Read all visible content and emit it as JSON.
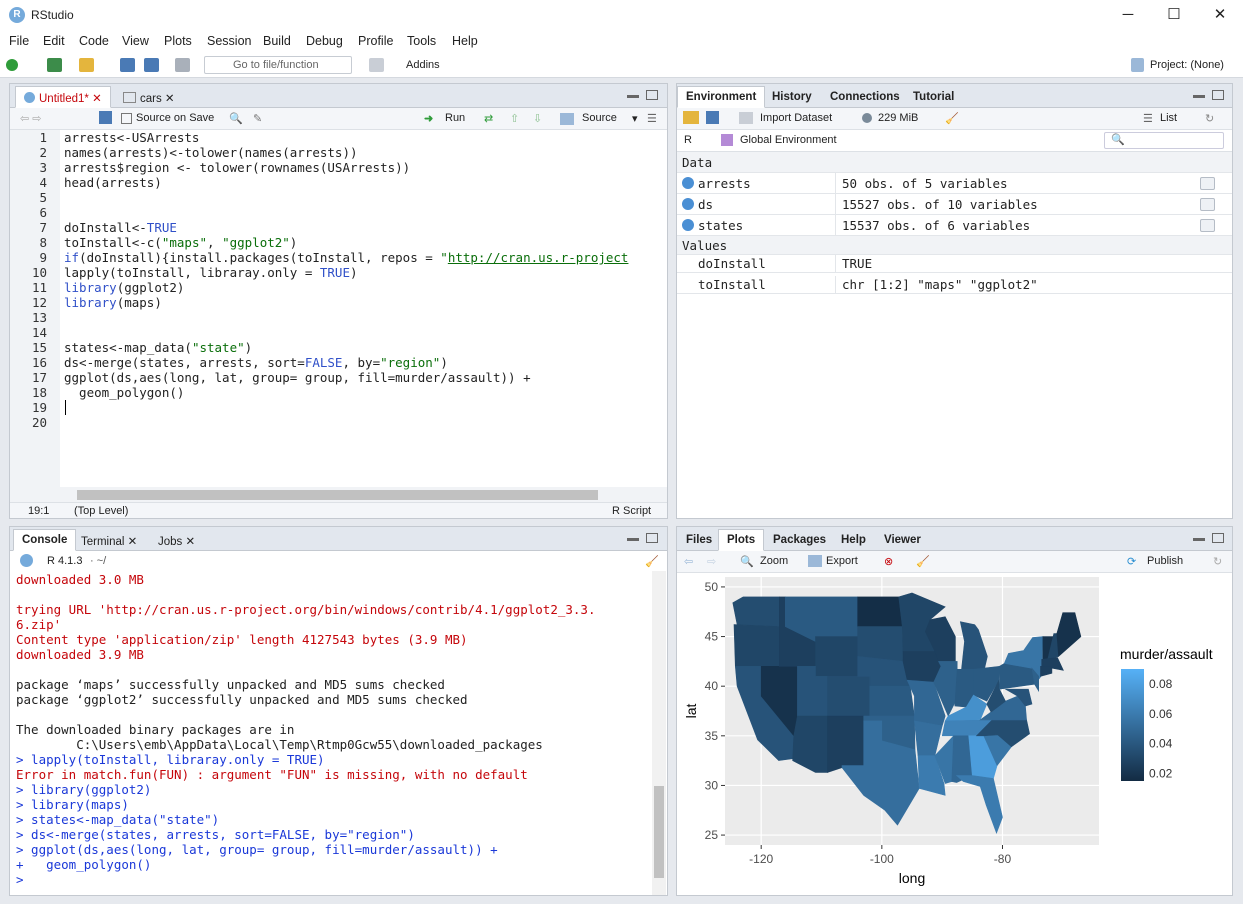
{
  "window": {
    "title": "RStudio",
    "minimize": "─",
    "maximize": "☐",
    "close": "✕"
  },
  "menu": [
    "File",
    "Edit",
    "Code",
    "View",
    "Plots",
    "Session",
    "Build",
    "Debug",
    "Profile",
    "Tools",
    "Help"
  ],
  "toolbar": {
    "goto_placeholder": "Go to file/function",
    "addins": "Addins",
    "project": "Project: (None)"
  },
  "editor": {
    "tabs": [
      "Untitled1*",
      "cars"
    ],
    "source_on_save": "Source on Save",
    "run": "Run",
    "source": "Source",
    "status": {
      "position": "19:1",
      "scope": "(Top Level)",
      "type": "R Script"
    },
    "lines": [
      [
        [
          "arrests<-USArrests",
          ""
        ]
      ],
      [
        [
          "names(arrests)<-tolower(names(arrests))",
          ""
        ]
      ],
      [
        [
          "arrests$region <- tolower(rownames(USArrests))",
          ""
        ]
      ],
      [
        [
          "head(arrests)",
          ""
        ]
      ],
      [],
      [],
      [
        [
          "doInstall<-",
          ""
        ],
        [
          "TRUE",
          "kw"
        ]
      ],
      [
        [
          "toInstall<-c(",
          ""
        ],
        [
          "\"maps\"",
          "str"
        ],
        [
          ", ",
          ""
        ],
        [
          "\"ggplot2\"",
          "str"
        ],
        [
          ")",
          ""
        ]
      ],
      [
        [
          "if",
          "kw"
        ],
        [
          "(doInstall){install.packages(toInstall, repos = ",
          ""
        ],
        [
          "\"",
          "str"
        ],
        [
          "http://cran.us.r-project",
          "lnk"
        ]
      ],
      [
        [
          "lapply(toInstall, libraray.only = ",
          ""
        ],
        [
          "TRUE",
          "kw"
        ],
        [
          ")",
          ""
        ]
      ],
      [
        [
          "library",
          "kw"
        ],
        [
          "(ggplot2)",
          ""
        ]
      ],
      [
        [
          "library",
          "kw"
        ],
        [
          "(maps)",
          ""
        ]
      ],
      [],
      [],
      [
        [
          "states<-map_data(",
          ""
        ],
        [
          "\"state\"",
          "str"
        ],
        [
          ")",
          ""
        ]
      ],
      [
        [
          "ds<-merge(states, arrests, sort=",
          ""
        ],
        [
          "FALSE",
          "kw"
        ],
        [
          ", by=",
          ""
        ],
        [
          "\"region\"",
          "str"
        ],
        [
          ")",
          ""
        ]
      ],
      [
        [
          "ggplot(ds,aes(long, lat, group= group, fill=murder/assault)) +",
          ""
        ]
      ],
      [
        [
          "  geom_polygon()",
          ""
        ]
      ],
      [],
      []
    ]
  },
  "console": {
    "tabs": [
      "Console",
      "Terminal",
      "Jobs"
    ],
    "version": "R 4.1.3",
    "path": "· ~/",
    "lines": [
      [
        "downloaded 3.0 MB",
        "red"
      ],
      [
        "",
        ""
      ],
      [
        "trying URL 'http://cran.us.r-project.org/bin/windows/contrib/4.1/ggplot2_3.3.",
        "red"
      ],
      [
        "6.zip'",
        "red"
      ],
      [
        "Content type 'application/zip' length 4127543 bytes (3.9 MB)",
        "red"
      ],
      [
        "downloaded 3.9 MB",
        "red"
      ],
      [
        "",
        ""
      ],
      [
        "package ‘maps’ successfully unpacked and MD5 sums checked",
        ""
      ],
      [
        "package ‘ggplot2’ successfully unpacked and MD5 sums checked",
        ""
      ],
      [
        "",
        ""
      ],
      [
        "The downloaded binary packages are in",
        ""
      ],
      [
        "        C:\\Users\\emb\\AppData\\Local\\Temp\\Rtmp0Gcw55\\downloaded_packages",
        ""
      ],
      [
        "> lapply(toInstall, libraray.only = TRUE)",
        "blue"
      ],
      [
        "Error in match.fun(FUN) : argument \"FUN\" is missing, with no default",
        "red"
      ],
      [
        "> library(ggplot2)",
        "blue"
      ],
      [
        "> library(maps)",
        "blue"
      ],
      [
        "> states<-map_data(\"state\")",
        "blue"
      ],
      [
        "> ds<-merge(states, arrests, sort=FALSE, by=\"region\")",
        "blue"
      ],
      [
        "> ggplot(ds,aes(long, lat, group= group, fill=murder/assault)) +",
        "blue"
      ],
      [
        "+   geom_polygon()",
        "blue"
      ],
      [
        "> ",
        "blue"
      ]
    ]
  },
  "environment": {
    "tabs": [
      "Environment",
      "History",
      "Connections",
      "Tutorial"
    ],
    "import": "Import Dataset",
    "memory": "229 MiB",
    "view": "List",
    "lang": "R",
    "scope": "Global Environment",
    "data_header": "Data",
    "values_header": "Values",
    "data": [
      [
        "arrests",
        "50 obs. of 5 variables"
      ],
      [
        "ds",
        "15527 obs. of 10 variables"
      ],
      [
        "states",
        "15537 obs. of 6 variables"
      ]
    ],
    "values": [
      [
        "doInstall",
        "TRUE"
      ],
      [
        "toInstall",
        "chr [1:2] \"maps\" \"ggplot2\""
      ]
    ]
  },
  "files": {
    "tabs": [
      "Files",
      "Plots",
      "Packages",
      "Help",
      "Viewer"
    ],
    "zoom": "Zoom",
    "export": "Export",
    "publish": "Publish"
  },
  "chart_data": {
    "type": "map",
    "xlabel": "long",
    "ylabel": "lat",
    "xticks": [
      -120,
      -100,
      -80
    ],
    "yticks": [
      25,
      30,
      35,
      40,
      45,
      50
    ],
    "xlim": [
      -126,
      -64
    ],
    "ylim": [
      24,
      51
    ],
    "legend": {
      "title": "murder/assault",
      "ticks": [
        0.08,
        0.06,
        0.04,
        0.02
      ],
      "range": [
        0.015,
        0.09
      ],
      "low_color": "#132b43",
      "high_color": "#56b1f7"
    }
  }
}
